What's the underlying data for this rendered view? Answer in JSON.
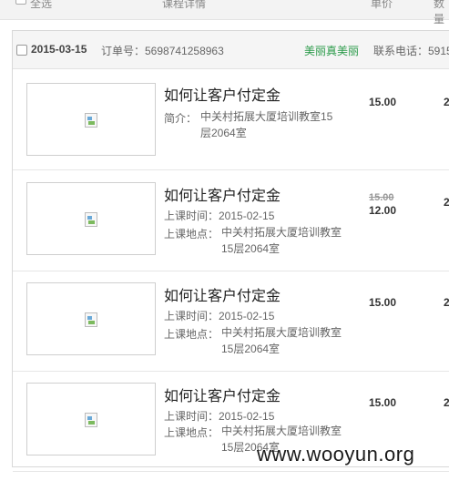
{
  "header": {
    "select_all": "全选",
    "col_detail": "课程详情",
    "col_price": "单价",
    "col_qty": "数量"
  },
  "order": {
    "date": "2015-03-15",
    "order_no": "订单号：5698741258963",
    "shop": "美丽真美丽",
    "contact": "联系电话：5915"
  },
  "items": [
    {
      "title": "如何让客户付定金",
      "intro_label": "简介：",
      "intro_text": "中关村拓展大厦培训教室15层2064室",
      "price": "15.00",
      "qty": "2"
    },
    {
      "title": "如何让客户付定金",
      "time": "上课时间：2015-02-15",
      "loc_label": "上课地点：",
      "loc_text": "中关村拓展大厦培训教室15层2064室",
      "old_price": "15.00",
      "price": "12.00",
      "qty": "2"
    },
    {
      "title": "如何让客户付定金",
      "time": "上课时间：2015-02-15",
      "loc_label": "上课地点：",
      "loc_text": "中关村拓展大厦培训教室15层2064室",
      "price": "15.00",
      "qty": "2"
    },
    {
      "title": "如何让客户付定金",
      "time": "上课时间：2015-02-15",
      "loc_label": "上课地点：",
      "loc_text": "中关村拓展大厦培训教室15层2064室",
      "price": "15.00",
      "qty": "2"
    }
  ],
  "watermark": "www.wooyun.org"
}
